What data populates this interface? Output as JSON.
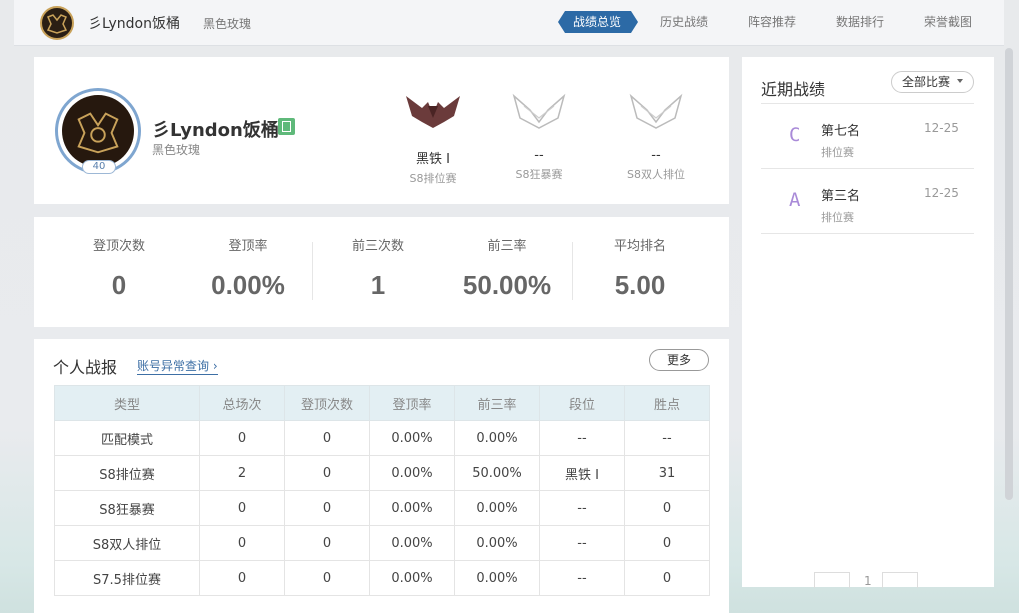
{
  "topbar": {
    "player_name": "彡Lyndon饭桶",
    "server": "黑色玫瑰",
    "nav": [
      "战绩总览",
      "历史战绩",
      "阵容推荐",
      "数据排行",
      "荣誉截图"
    ],
    "active_nav": "战绩总览"
  },
  "profile": {
    "name": "彡Lyndon饭桶",
    "server": "黑色玫瑰",
    "level": "40",
    "ranks": [
      {
        "value": "黑铁 Ⅰ",
        "mode": "S8排位赛",
        "icon": "iron-emblem-icon"
      },
      {
        "value": "--",
        "mode": "S8狂暴赛",
        "icon": "unranked-emblem-icon"
      },
      {
        "value": "--",
        "mode": "S8双人排位",
        "icon": "unranked-emblem-icon"
      }
    ]
  },
  "stats": [
    {
      "label": "登顶次数",
      "value": "0"
    },
    {
      "label": "登顶率",
      "value": "0.00%"
    },
    {
      "label": "前三次数",
      "value": "1"
    },
    {
      "label": "前三率",
      "value": "50.00%"
    },
    {
      "label": "平均排名",
      "value": "5.00"
    }
  ],
  "report": {
    "title": "个人战报",
    "link": "账号异常查询",
    "more": "更多",
    "columns": [
      "类型",
      "总场次",
      "登顶次数",
      "登顶率",
      "前三率",
      "段位",
      "胜点"
    ],
    "rows": [
      [
        "匹配模式",
        "0",
        "0",
        "0.00%",
        "0.00%",
        "--",
        "--"
      ],
      [
        "S8排位赛",
        "2",
        "0",
        "0.00%",
        "50.00%",
        "黑铁 Ⅰ",
        "31"
      ],
      [
        "S8狂暴赛",
        "0",
        "0",
        "0.00%",
        "0.00%",
        "--",
        "0"
      ],
      [
        "S8双人排位",
        "0",
        "0",
        "0.00%",
        "0.00%",
        "--",
        "0"
      ],
      [
        "S7.5排位赛",
        "0",
        "0",
        "0.00%",
        "0.00%",
        "--",
        "0"
      ]
    ]
  },
  "recent": {
    "title": "近期战绩",
    "filter": "全部比赛",
    "matches": [
      {
        "grade": "C",
        "place": "第七名",
        "mode": "排位赛",
        "date": "12-25"
      },
      {
        "grade": "A",
        "place": "第三名",
        "mode": "排位赛",
        "date": "12-25"
      }
    ],
    "page": "1"
  },
  "colors": {
    "accent": "#2c6aa6",
    "grade": "#a98ad8",
    "table_header": "#e3eff3"
  }
}
